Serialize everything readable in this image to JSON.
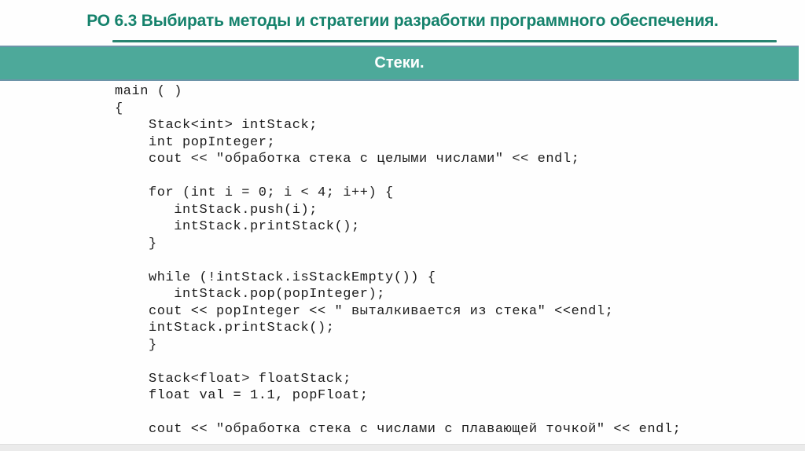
{
  "slide": {
    "header": "РО 6.3 Выбирать методы и стратегии разработки программного обеспечения.",
    "banner": "Стеки."
  },
  "code": {
    "language": "cpp",
    "lines": [
      "main ( )",
      "{",
      "    Stack<int> intStack;",
      "    int popInteger;",
      "    cout << \"обработка стека с целыми числами\" << endl;",
      "",
      "    for (int i = 0; i < 4; i++) {",
      "       intStack.push(i);",
      "       intStack.printStack();",
      "    }",
      "",
      "    while (!intStack.isStackEmpty()) {",
      "       intStack.pop(popInteger);",
      "    cout << popInteger << \" выталкивается из стека\" <<endl;",
      "    intStack.printStack();",
      "    }",
      "",
      "    Stack<float> floatStack;",
      "    float val = 1.1, popFloat;",
      "",
      "    cout << \"обработка стека с числами с плавающей точкой\" << endl;"
    ]
  },
  "colors": {
    "header-text": "#15826C",
    "underline": "#1D7A67",
    "banner-fill": "#4DA99A",
    "banner-border": "#6D94A9",
    "banner-text": "#FFFFFF",
    "code-text": "#1C1C1C",
    "bottom-strip": "#EBEBEB"
  }
}
